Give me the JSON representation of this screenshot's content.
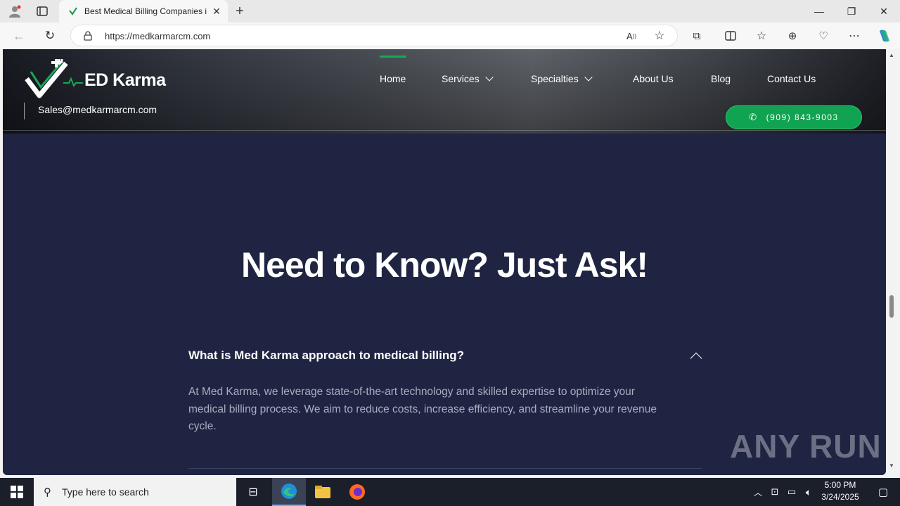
{
  "browser": {
    "tab_title": "Best Medical Billing Companies i",
    "url": "https://medkarmarcm.com"
  },
  "site": {
    "brand": "ED Karma",
    "email": "Sales@medkarmarcm.com",
    "nav": [
      "Home",
      "Services",
      "Specialties",
      "About Us",
      "Blog",
      "Contact Us"
    ],
    "phone": "(909) 843-9003"
  },
  "faq": {
    "title": "Need to Know? Just Ask!",
    "question": "What is Med Karma approach to medical billing?",
    "answer": "At Med Karma, we leverage state-of-the-art technology and skilled expertise to optimize your medical billing process. We aim to reduce costs, increase efficiency, and streamline your revenue cycle."
  },
  "watermark": "ANY RUN",
  "taskbar": {
    "search_placeholder": "Type here to search",
    "time": "5:00 PM",
    "date": "3/24/2025"
  },
  "colors": {
    "page_bg": "#1f2442",
    "accent_green": "#10a352"
  }
}
